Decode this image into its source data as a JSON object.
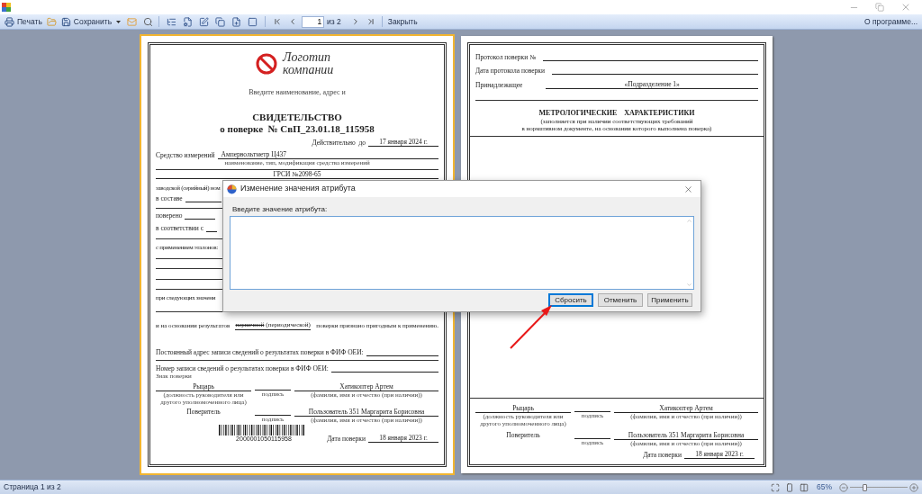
{
  "toolbar": {
    "print": "Печать",
    "save": "Сохранить",
    "page_input": "1",
    "page_total": "из 2",
    "close": "Закрыть",
    "about": "О программе..."
  },
  "pages": [
    {
      "kind": "certificate",
      "selected": true,
      "logo_text": "Логотип компании",
      "org_hint": "Введите наименование, адрес и",
      "title": "СВИДЕТЕЛЬСТВО",
      "subtitle": "о поверке  № СвП_23.01.18_115958",
      "valid_label": "Действительно  до",
      "valid_value": "17 января 2024 г.",
      "instrument_label": "Средство измерений",
      "instrument_value": "Ампервольтметр Ц437",
      "instrument_caption": "наименование, тип, модификация средства измерений",
      "registry": "ГРСИ №2098-65",
      "serial_label": "заводской (серийный) ном",
      "composition_label": "в составе",
      "verified_label": "поверено",
      "accordance_label": "в соответствии с",
      "standards_label": "с применением эталонов:",
      "conditions_label": "при следующих значени",
      "result_prefix": "и на основании результатов",
      "result_struck": "первичной",
      "result_type": "(периодической)",
      "result_suffix": "поверки признано пригодным к применению.",
      "fif_address_label": "Постоянный адрес записи сведений о результатах поверки в ФИФ ОЕИ:",
      "fif_number_label": "Номер записи сведений о результатах поверки в ФИФ ОЕИ:",
      "mark_label": "Знак поверки",
      "barcode_number": "2000001050115958",
      "signatures": [
        {
          "role": "Рыцарь",
          "underlined": true,
          "role_caption": "(должность руководителя или другого уполномоченного лица)",
          "sign_caption": "подпись",
          "person": "Хатикоптер Артем",
          "person_caption": "(фамилия, имя и отчество (при наличии))"
        },
        {
          "role": "Поверитель",
          "underlined": false,
          "sign_caption": "подпись",
          "person": "Пользователь 351 Маргарита Борисовна",
          "person_caption": "(фамилия, имя и отчество (при наличии))"
        }
      ],
      "date_label": "Дата поверки",
      "date_value": "18 января 2023 г."
    },
    {
      "kind": "protocol",
      "selected": false,
      "fields": [
        {
          "label": "Протокол поверки №"
        },
        {
          "label": "Дата протокола поверки"
        },
        {
          "label": "Принадлежащее",
          "value": "«Подразделение 1»"
        }
      ],
      "heading": "МЕТРОЛОГИЧЕСКИЕ    ХАРАКТЕРИСТИКИ",
      "note": [
        "(заполняется при наличии соответствующих требований",
        "в нормативном документе, на основании которого выполнена поверка)"
      ],
      "signatures": [
        {
          "role": "Рыцарь",
          "underlined": true,
          "role_caption": "(должность руководителя или другого уполномоченного лица)",
          "sign_caption": "подпись",
          "person": "Хатикоптер Артем",
          "person_caption": "(фамилия, имя и отчество (при наличии))"
        },
        {
          "role": "Поверитель",
          "underlined": false,
          "sign_caption": "подпись",
          "person": "Пользователь 351 Маргарита Борисовна",
          "person_caption": "(фамилия, имя и отчество (при наличии))"
        }
      ],
      "date_label": "Дата поверки",
      "date_value": "18 января 2023 г."
    }
  ],
  "dialog": {
    "title": "Изменение значения атрибута",
    "prompt": "Введите значение атрибута:",
    "buttons": [
      {
        "label": "Сбросить",
        "focused": true
      },
      {
        "label": "Отменить",
        "focused": false
      },
      {
        "label": "Применить",
        "focused": false
      }
    ]
  },
  "status_bar": {
    "page": "Страница 1 из 2",
    "zoom": "65%",
    "zoom_slider": {
      "level": 0.25
    }
  }
}
